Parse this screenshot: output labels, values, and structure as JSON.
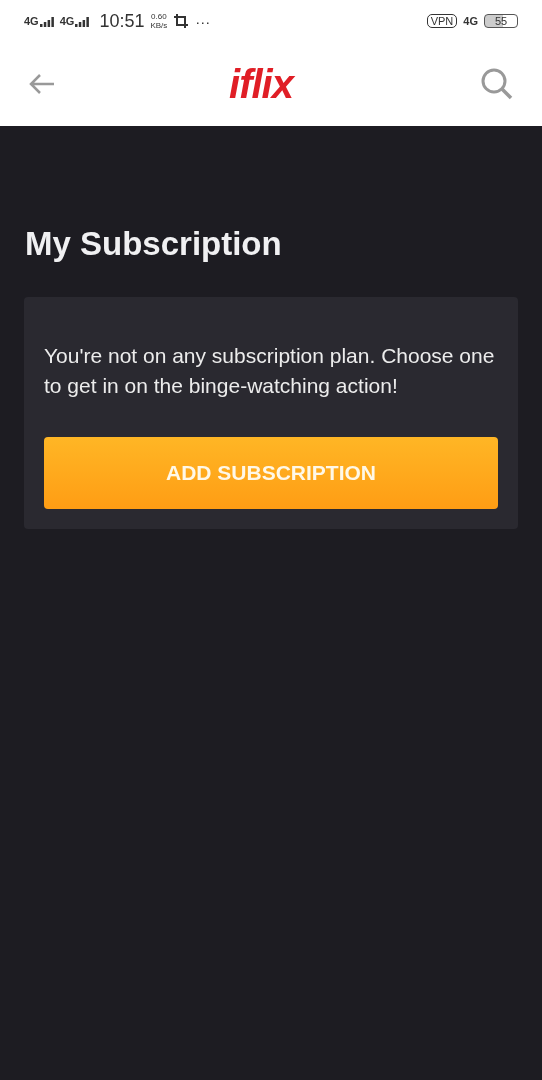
{
  "status_bar": {
    "network_1": "4G",
    "network_2": "4G",
    "time": "10:51",
    "speed_value": "0.60",
    "speed_unit": "KB/s",
    "more": "···",
    "vpn": "VPN",
    "network_3": "4G",
    "battery": "55"
  },
  "header": {
    "logo": "iflix"
  },
  "page": {
    "title": "My Subscription"
  },
  "card": {
    "message": "You're not on any subscription plan. Choose one to get in on the binge-watching action!",
    "button": "ADD SUBSCRIPTION"
  }
}
